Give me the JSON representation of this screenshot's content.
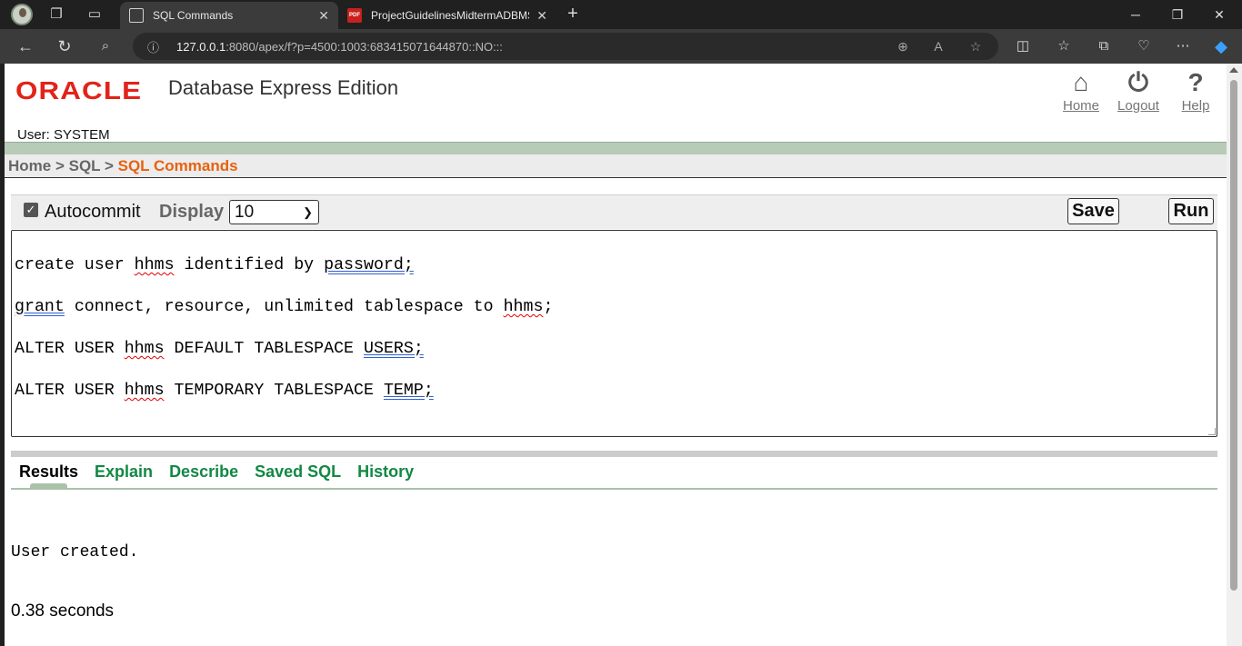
{
  "browser": {
    "tabs": [
      {
        "title": "SQL Commands",
        "active": true
      },
      {
        "title": "ProjectGuidelinesMidtermADBMS",
        "active": false
      }
    ],
    "url_host": "127.0.0.1",
    "url_rest": ":8080/apex/f?p=4500:1003:683415071644870::NO:::"
  },
  "header": {
    "logo": "ORACLE",
    "product": "Database Express Edition",
    "links": [
      "Home",
      "Logout",
      "Help"
    ],
    "user": "User: SYSTEM"
  },
  "breadcrumb": {
    "home": "Home",
    "sep": " > ",
    "sql": "SQL",
    "current": "SQL Commands"
  },
  "commandbar": {
    "autocommit_label": "Autocommit",
    "autocommit_checked": true,
    "display_label": "Display",
    "display_value": "10",
    "save_label": "Save",
    "run_label": "Run"
  },
  "editor": {
    "lines": [
      "create user hhms identified by password;",
      "grant connect, resource, unlimited tablespace to hhms;",
      "ALTER USER hhms DEFAULT TABLESPACE USERS;",
      "ALTER USER hhms TEMPORARY TABLESPACE TEMP;"
    ]
  },
  "result_tabs": [
    "Results",
    "Explain",
    "Describe",
    "Saved SQL",
    "History"
  ],
  "results": {
    "message": "User created.",
    "timing": "0.38 seconds"
  },
  "colors": {
    "oracle_red": "#e2231a",
    "breadcrumb_current": "#e8610e",
    "tab_link": "#118844",
    "bar_green": "#b7cbb7"
  }
}
